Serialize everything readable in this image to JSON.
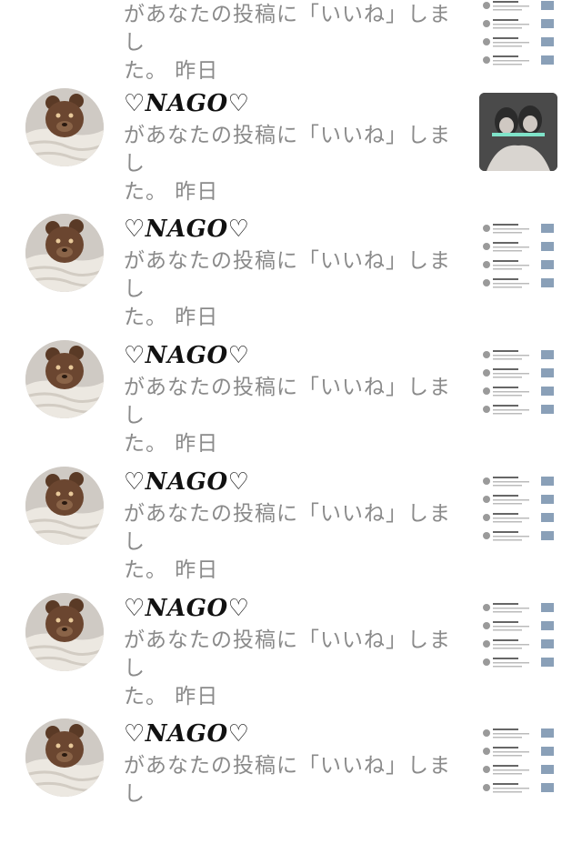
{
  "notifications": [
    {
      "name": "",
      "message": "があなたの投稿に「いいね」しました。",
      "time": "昨日",
      "thumb": "screenshot"
    },
    {
      "name": "♡NAGO♡",
      "message": "があなたの投稿に「いいね」しました。",
      "time": "昨日",
      "thumb": "photo"
    },
    {
      "name": "♡NAGO♡",
      "message": "があなたの投稿に「いいね」しました。",
      "time": "昨日",
      "thumb": "screenshot"
    },
    {
      "name": "♡NAGO♡",
      "message": "があなたの投稿に「いいね」しました。",
      "time": "昨日",
      "thumb": "screenshot"
    },
    {
      "name": "♡NAGO♡",
      "message": "があなたの投稿に「いいね」しました。",
      "time": "昨日",
      "thumb": "screenshot"
    },
    {
      "name": "♡NAGO♡",
      "message": "があなたの投稿に「いいね」しました。",
      "time": "昨日",
      "thumb": "screenshot"
    },
    {
      "name": "♡NAGO♡",
      "message": "があなたの投稿に「いいね」しました。",
      "time": "",
      "thumb": "profile"
    }
  ],
  "message_line1": "があなたの投稿に「いいね」しまし",
  "message_line2": "た。 昨日",
  "colors": {
    "name": "#111111",
    "message": "#8a8a8a",
    "background": "#ffffff"
  },
  "icons": {
    "avatar": "teddy-bear-avatar-icon"
  }
}
